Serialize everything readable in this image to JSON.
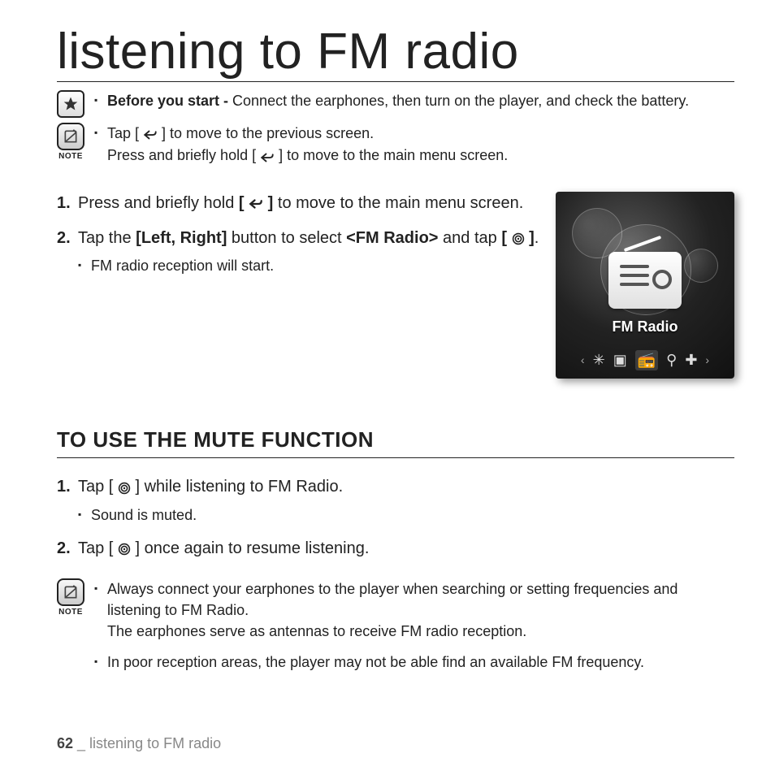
{
  "title": "listening to FM radio",
  "intro": {
    "before_label": "Before you start -",
    "before_text": " Connect the earphones, then turn on the player, and check the battery."
  },
  "note1": {
    "label": "NOTE",
    "line1a": "Tap [ ",
    "line1b": " ] to move to the previous screen.",
    "line2a": "Press and briefly hold [ ",
    "line2b": " ] to move to the main menu screen."
  },
  "steps": {
    "s1a": "Press and briefly hold ",
    "s1b_bold_open": "[ ",
    "s1b_bold_close": " ]",
    "s1c": " to move to the main menu screen.",
    "s2a": "Tap the ",
    "s2b": "[Left, Right]",
    "s2c": " button to select ",
    "s2d": "<FM Radio>",
    "s2e": " and tap ",
    "s2f_open": "[ ",
    "s2f_close": " ]",
    "s2g": ".",
    "s2_sub": "FM radio reception will start."
  },
  "device": {
    "label": "FM Radio"
  },
  "section2": {
    "title": "TO USE THE MUTE FUNCTION",
    "s1a": "Tap [ ",
    "s1b": " ] while listening to FM Radio.",
    "s1_sub": "Sound is muted.",
    "s2a": "Tap [ ",
    "s2b": " ] once again to resume listening."
  },
  "note2": {
    "label": "NOTE",
    "b1a": "Always connect your earphones to the player when searching or setting frequencies and listening to FM Radio.",
    "b1b": "The earphones serve as antennas to receive FM radio reception.",
    "b2": "In poor reception areas, the player may not be able find an available FM frequency."
  },
  "footer": {
    "page": "62",
    "sep": " _ ",
    "text": "listening to FM radio"
  }
}
